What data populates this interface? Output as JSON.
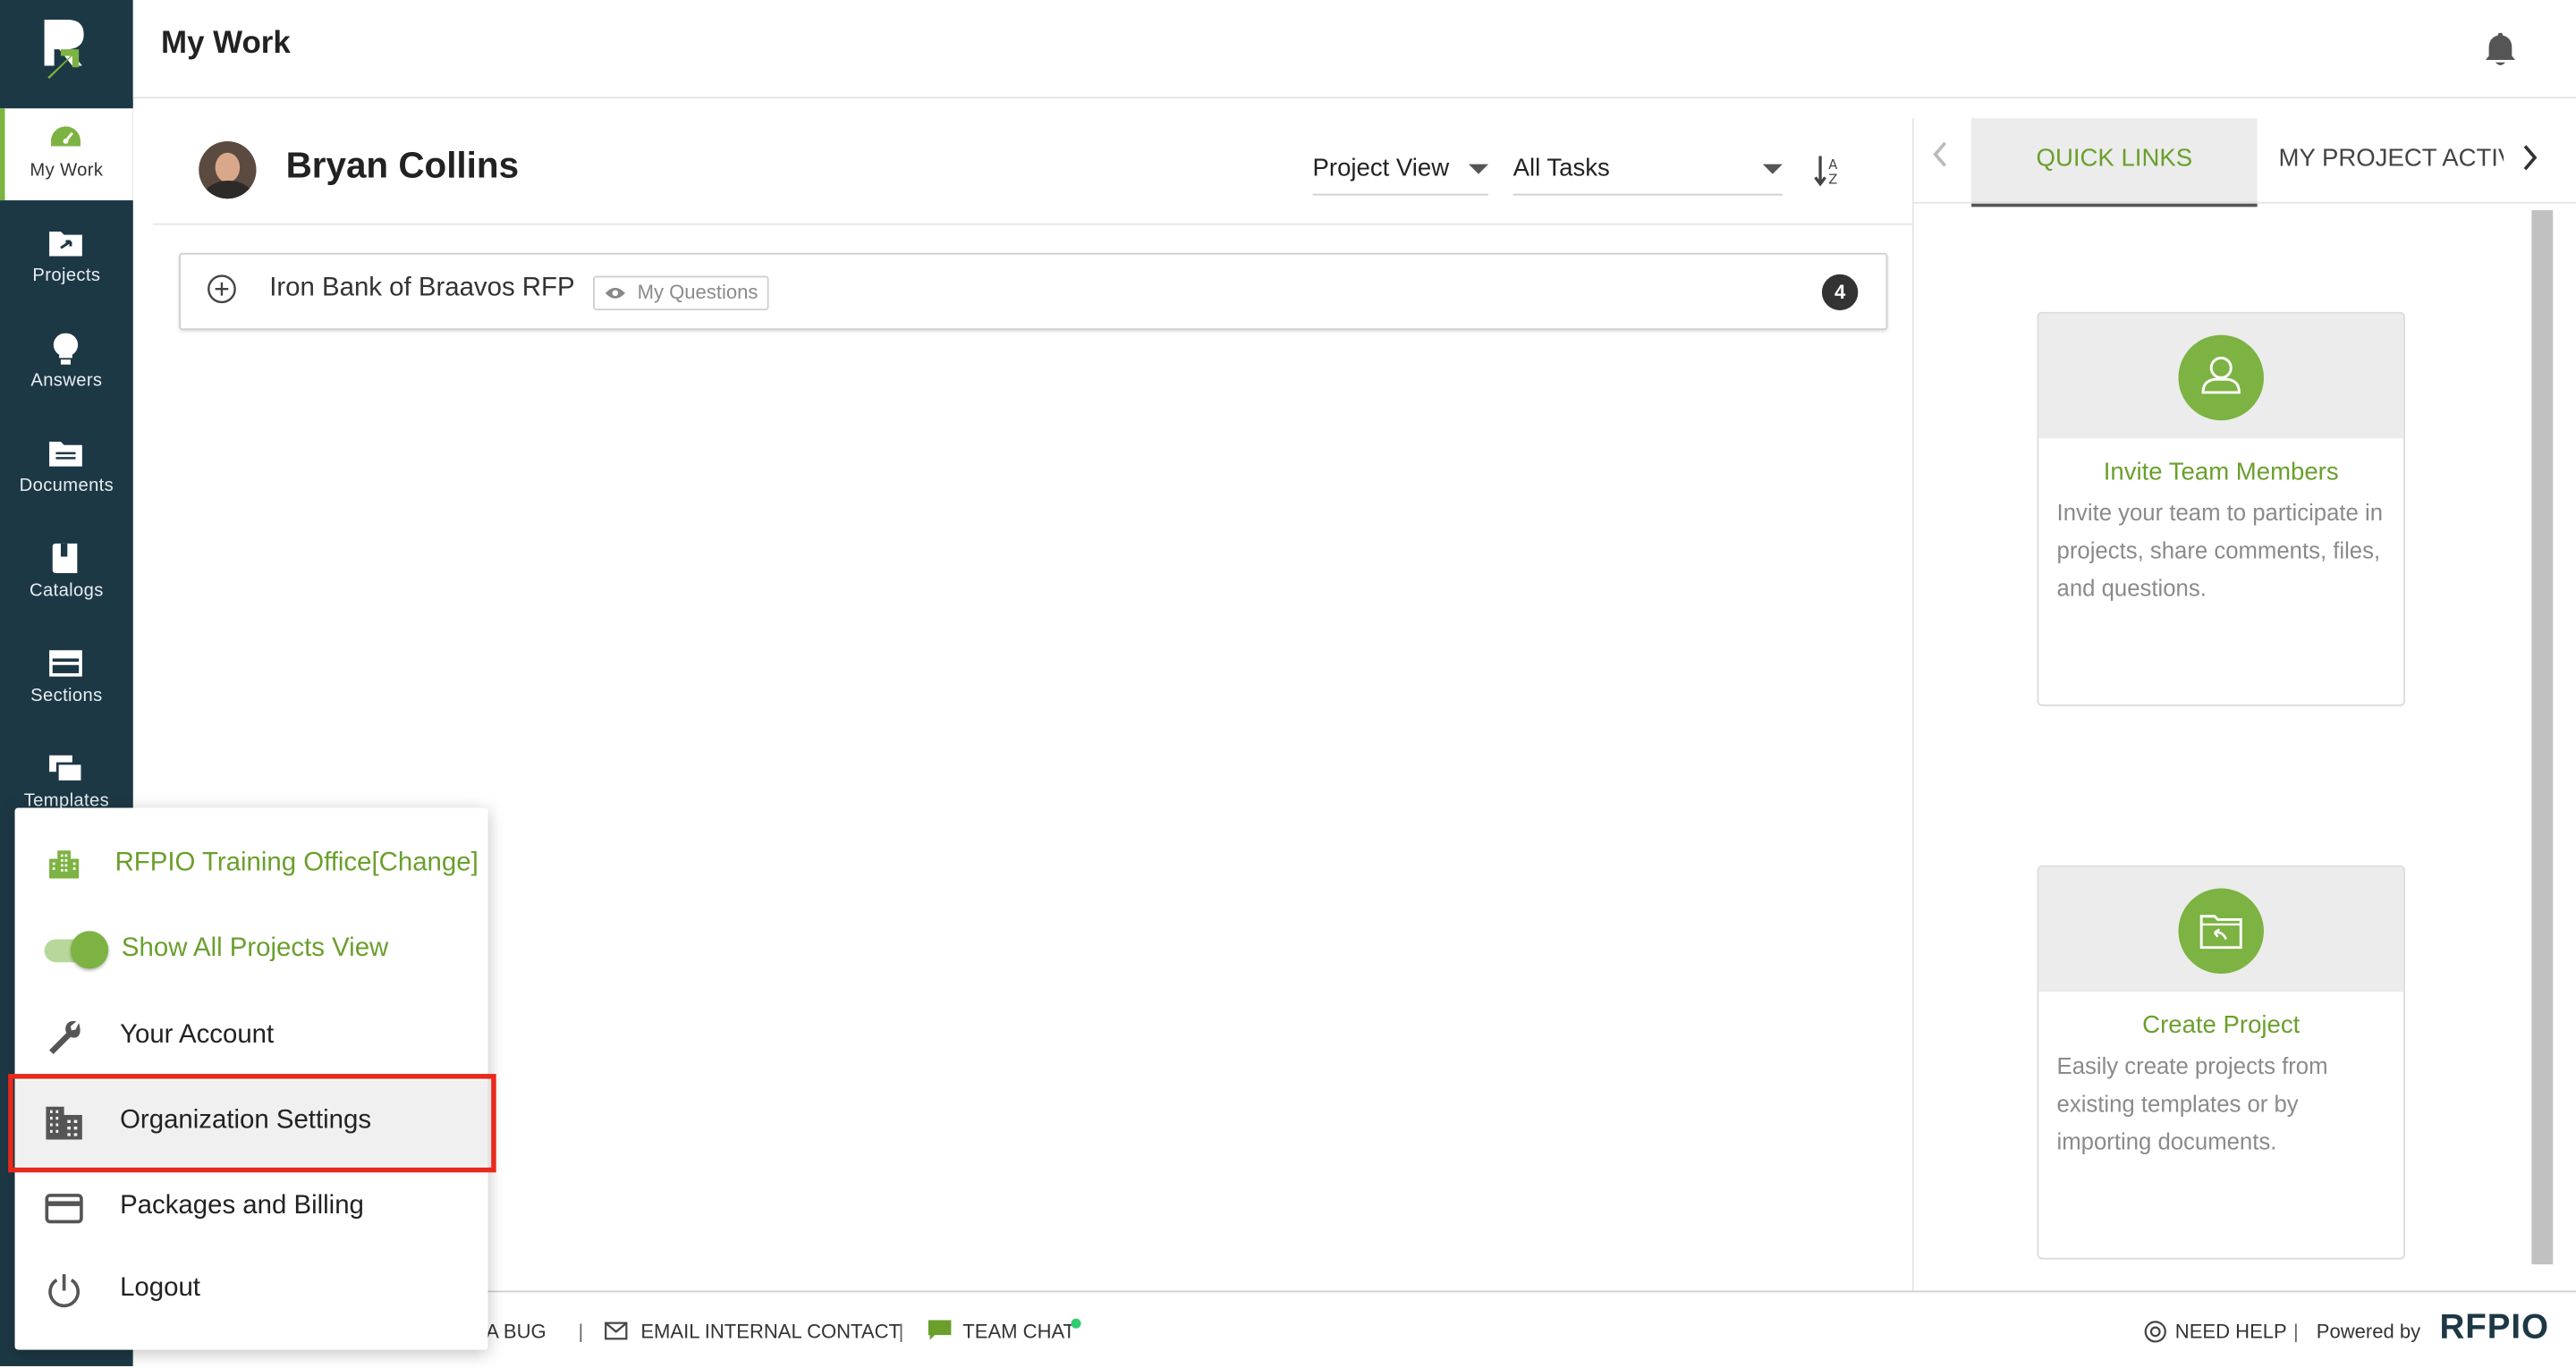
{
  "header": {
    "title": "My Work"
  },
  "sidebar": {
    "items": [
      {
        "label": "My Work",
        "icon": "dashboard-icon",
        "active": true
      },
      {
        "label": "Projects",
        "icon": "folder-share-icon"
      },
      {
        "label": "Answers",
        "icon": "lightbulb-icon"
      },
      {
        "label": "Documents",
        "icon": "documents-icon"
      },
      {
        "label": "Catalogs",
        "icon": "book-icon"
      },
      {
        "label": "Sections",
        "icon": "sections-icon"
      },
      {
        "label": "Templates",
        "icon": "templates-icon"
      }
    ]
  },
  "user": {
    "name": "Bryan Collins"
  },
  "filters": {
    "view_value": "Project View",
    "task_value": "All Tasks"
  },
  "projects": [
    {
      "name": "Iron Bank of Braavos RFP",
      "tag": "My Questions",
      "count": "4"
    }
  ],
  "right_panel": {
    "tabs": [
      {
        "label": "QUICK LINKS",
        "active": true
      },
      {
        "label": "MY PROJECT ACTIVITI"
      }
    ],
    "cards": [
      {
        "title": "Invite Team Members",
        "description": "Invite your team to participate in projects, share comments, files, and questions."
      },
      {
        "title": "Create Project",
        "description": "Easily create projects from existing templates or by importing documents."
      }
    ]
  },
  "menu": {
    "org_name": "RFPIO Training Office[Change]",
    "toggle_label": "Show All Projects View",
    "toggle_on": true,
    "items": [
      {
        "label": "Your Account",
        "icon": "wrench-icon"
      },
      {
        "label": "Organization Settings",
        "icon": "building-icon",
        "highlighted": true
      },
      {
        "label": "Packages and Billing",
        "icon": "credit-card-icon"
      },
      {
        "label": "Logout",
        "icon": "power-icon"
      }
    ]
  },
  "footer": {
    "report_bug": "T A BUG",
    "email_contact": "EMAIL INTERNAL CONTACT",
    "team_chat": "TEAM CHAT",
    "separator": "|",
    "need_help": "NEED HELP",
    "powered_by": "Powered by",
    "brand": "RFPIO"
  },
  "colors": {
    "sidebar_bg": "#1d3845",
    "accent_green": "#7cb342",
    "highlight_red": "#e8291c"
  }
}
